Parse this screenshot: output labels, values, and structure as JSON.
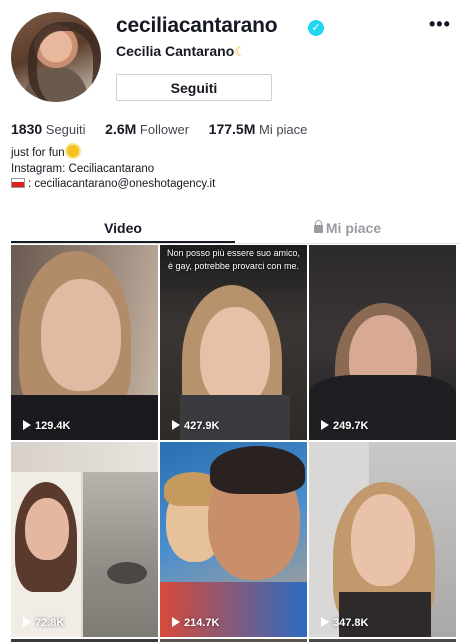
{
  "profile": {
    "username": "ceciliacantarano",
    "display_name": "Cecilia Cantarano",
    "follow_button": "Seguiti",
    "more": "•••"
  },
  "stats": [
    {
      "value": "1830",
      "label": "Seguiti"
    },
    {
      "value": "2.6M",
      "label": "Follower"
    },
    {
      "value": "177.5M",
      "label": "Mi piace"
    }
  ],
  "bio": {
    "line1": "just for fun",
    "line2": "Instagram: Ceciliacantarano",
    "line3": ": ceciliacantarano@oneshotagency.it"
  },
  "tabs": {
    "video": "Video",
    "likes": "Mi piace"
  },
  "videos": [
    {
      "views": "129.4K"
    },
    {
      "views": "427.9K",
      "caption": "Non posso più essere suo amico, è gay, potrebbe provarci con me."
    },
    {
      "views": "249.7K"
    },
    {
      "views": "72.8K"
    },
    {
      "views": "214.7K"
    },
    {
      "views": "347.8K"
    }
  ],
  "colors": {
    "verified": "#20d5ec",
    "tab_active": "#161823",
    "tab_inactive": "#9a9ba0"
  },
  "icons": {
    "verified": "check-badge-icon",
    "more": "more-dots-icon",
    "lock": "lock-icon",
    "play": "play-icon"
  }
}
